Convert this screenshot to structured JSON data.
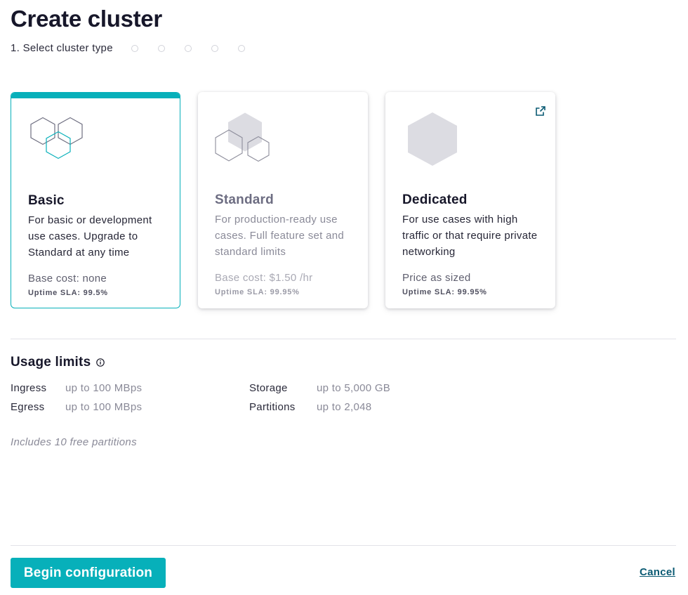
{
  "page": {
    "title": "Create cluster"
  },
  "stepper": {
    "current_step_label": "1. Select cluster type",
    "remaining_steps": 5
  },
  "cards": [
    {
      "id": "basic",
      "name": "Basic",
      "description": "For basic or development use cases. Upgrade to Standard at any time",
      "cost": "Base cost: none",
      "sla": "Uptime SLA: 99.5%",
      "selected": true
    },
    {
      "id": "standard",
      "name": "Standard",
      "description": "For production-ready use cases. Full feature set and standard limits",
      "cost": "Base cost: $1.50 /hr",
      "sla": "Uptime SLA: 99.95%",
      "selected": false
    },
    {
      "id": "dedicated",
      "name": "Dedicated",
      "description": "For use cases with high traffic or that require private networking",
      "cost": "Price as sized",
      "sla": "Uptime SLA: 99.95%",
      "selected": false,
      "external_link_icon": "external-link-icon"
    }
  ],
  "usage": {
    "title": "Usage limits",
    "rows": [
      {
        "label": "Ingress",
        "value": "up to 100 MBps"
      },
      {
        "label": "Egress",
        "value": "up to 100 MBps"
      },
      {
        "label": "Storage",
        "value": "up to 5,000 GB"
      },
      {
        "label": "Partitions",
        "value": "up to 2,048"
      }
    ],
    "note": "Includes 10 free partitions"
  },
  "footer": {
    "primary_label": "Begin configuration",
    "cancel_label": "Cancel"
  },
  "colors": {
    "accent": "#07b0ba",
    "link": "#0a5a73",
    "hex_gray": "#dcdce2"
  }
}
